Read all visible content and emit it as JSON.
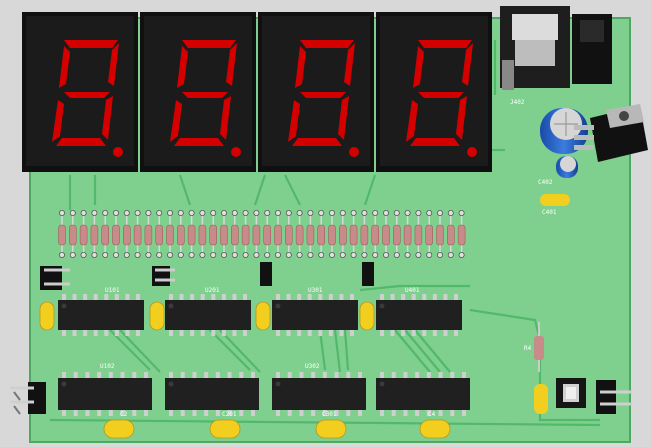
{
  "board": {
    "pcb_color": "#7fd08e",
    "trace_color": "#52b86a",
    "ic_color": "#202020",
    "resistor_color": "#c98a8a",
    "cap_yellow": "#f2cf1e"
  },
  "display": {
    "digits": [
      "8",
      "8",
      "8",
      "8"
    ],
    "segment_color": "#d40000",
    "housing_color": "#1b1b1b"
  },
  "labels": {
    "ic_top": [
      "U101",
      "U201",
      "U301",
      "U401"
    ],
    "ic_bottom": [
      "U102",
      "",
      "U302",
      ""
    ],
    "caps_bottom": [
      "C2",
      "C201",
      "C301",
      "C4"
    ],
    "right_side": [
      "J402",
      "C402",
      "C401",
      "R4"
    ]
  },
  "icons": {
    "connectors": "header-pin-icon",
    "button": "tactile-switch-icon",
    "regulator": "voltage-regulator-icon",
    "dc_jack": "dc-jack-icon"
  }
}
